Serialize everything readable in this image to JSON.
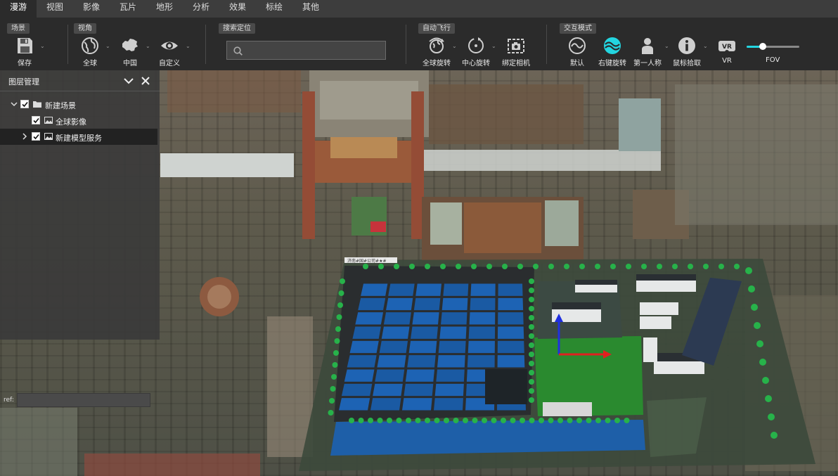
{
  "menu": {
    "tabs": [
      {
        "label": "漫游",
        "active": true
      },
      {
        "label": "视图"
      },
      {
        "label": "影像"
      },
      {
        "label": "瓦片"
      },
      {
        "label": "地形"
      },
      {
        "label": "分析"
      },
      {
        "label": "效果"
      },
      {
        "label": "标绘"
      },
      {
        "label": "其他"
      }
    ]
  },
  "toolbar": {
    "groups": {
      "scene": "场景",
      "view": "视角",
      "search": "搜索定位",
      "autofly": "自动飞行",
      "interact": "交互模式"
    },
    "tools": {
      "save": {
        "label": "保存",
        "icon": "floppy-disk-icon"
      },
      "globe": {
        "label": "全球",
        "icon": "globe-icon"
      },
      "china": {
        "label": "中国",
        "icon": "china-map-icon"
      },
      "custom": {
        "label": "自定义",
        "icon": "eye-icon"
      },
      "globe_rotate": {
        "label": "全球旋转",
        "icon": "globe-rotate-icon"
      },
      "center_rotate": {
        "label": "中心旋转",
        "icon": "center-rotate-icon"
      },
      "bind_camera": {
        "label": "绑定相机",
        "icon": "camera-icon"
      },
      "default": {
        "label": "默认",
        "icon": "default-mode-icon"
      },
      "right_rotate": {
        "label": "右键旋转",
        "icon": "right-rotate-icon",
        "active": true
      },
      "first_person": {
        "label": "第一人称",
        "icon": "person-icon"
      },
      "mouse_pick": {
        "label": "鼠标拾取",
        "icon": "info-icon"
      },
      "vr": {
        "label": "VR",
        "icon": "vr-headset-icon"
      }
    },
    "search": {
      "value": "",
      "placeholder": ""
    },
    "fov": {
      "label": "FOV",
      "value_fraction": 0.3
    }
  },
  "layer_panel": {
    "title": "图层管理",
    "tree": [
      {
        "label": "新建场景",
        "checked": true,
        "expanded": true,
        "icon": "folder-icon"
      },
      {
        "label": "全球影像",
        "checked": true,
        "icon": "image-icon"
      },
      {
        "label": "新建模型服务",
        "checked": true,
        "expanded": false,
        "selected": true,
        "icon": "image-icon"
      }
    ],
    "ref": {
      "label": "ref:",
      "value": ""
    }
  },
  "map": {
    "factory_sign": "济南#国#公司#★#"
  },
  "colors": {
    "accent": "#23d5e0",
    "menu_bg": "#3d3d3d",
    "toolbar_bg": "#2b2b2b",
    "panel_bg": "#3a3a3a",
    "axis_x": "#e02020",
    "axis_y": "#2030e0"
  }
}
